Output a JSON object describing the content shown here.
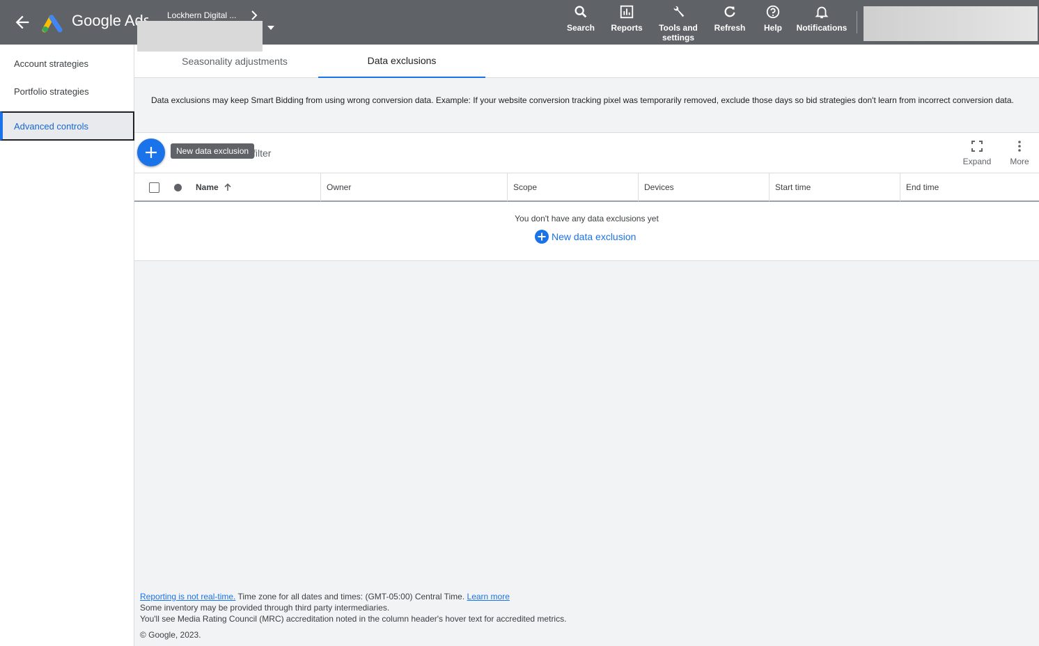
{
  "topbar": {
    "brand": "Google Ads",
    "account_name": "Lockhern Digital ...",
    "nav": [
      {
        "label": "Search",
        "icon": "search-icon"
      },
      {
        "label": "Reports",
        "icon": "reports-icon"
      },
      {
        "label": "Tools and settings",
        "icon": "wrench-icon"
      },
      {
        "label": "Refresh",
        "icon": "refresh-icon"
      },
      {
        "label": "Help",
        "icon": "help-icon"
      },
      {
        "label": "Notifications",
        "icon": "bell-icon"
      }
    ]
  },
  "sidebar": {
    "items": [
      {
        "label": "Account strategies"
      },
      {
        "label": "Portfolio strategies"
      },
      {
        "label": "Advanced controls"
      }
    ]
  },
  "tabs": [
    {
      "label": "Seasonality adjustments"
    },
    {
      "label": "Data exclusions"
    }
  ],
  "description": "Data exclusions may keep Smart Bidding from using wrong conversion data. Example: If your website conversion tracking pixel was temporarily removed, exclude those days so bid strategies don't learn from incorrect conversion data.",
  "toolbar": {
    "filter_label": "filter",
    "tooltip": "New data exclusion",
    "expand_label": "Expand",
    "more_label": "More"
  },
  "table": {
    "columns": [
      "Name",
      "Owner",
      "Scope",
      "Devices",
      "Start time",
      "End time"
    ],
    "empty_message": "You don't have any data exclusions yet",
    "empty_action": "New data exclusion"
  },
  "footer": {
    "realtime_link": "Reporting is not real-time.",
    "timezone": " Time zone for all dates and times: (GMT-05:00) Central Time. ",
    "learn_more": "Learn more",
    "inventory": "Some inventory may be provided through third party intermediaries.",
    "mrc": "You'll see Media Rating Council (MRC) accreditation noted in the column header's hover text for accredited metrics.",
    "copyright": "© Google, 2023."
  },
  "colors": {
    "topbar": "#5f6368",
    "accent": "#1a73e8"
  }
}
